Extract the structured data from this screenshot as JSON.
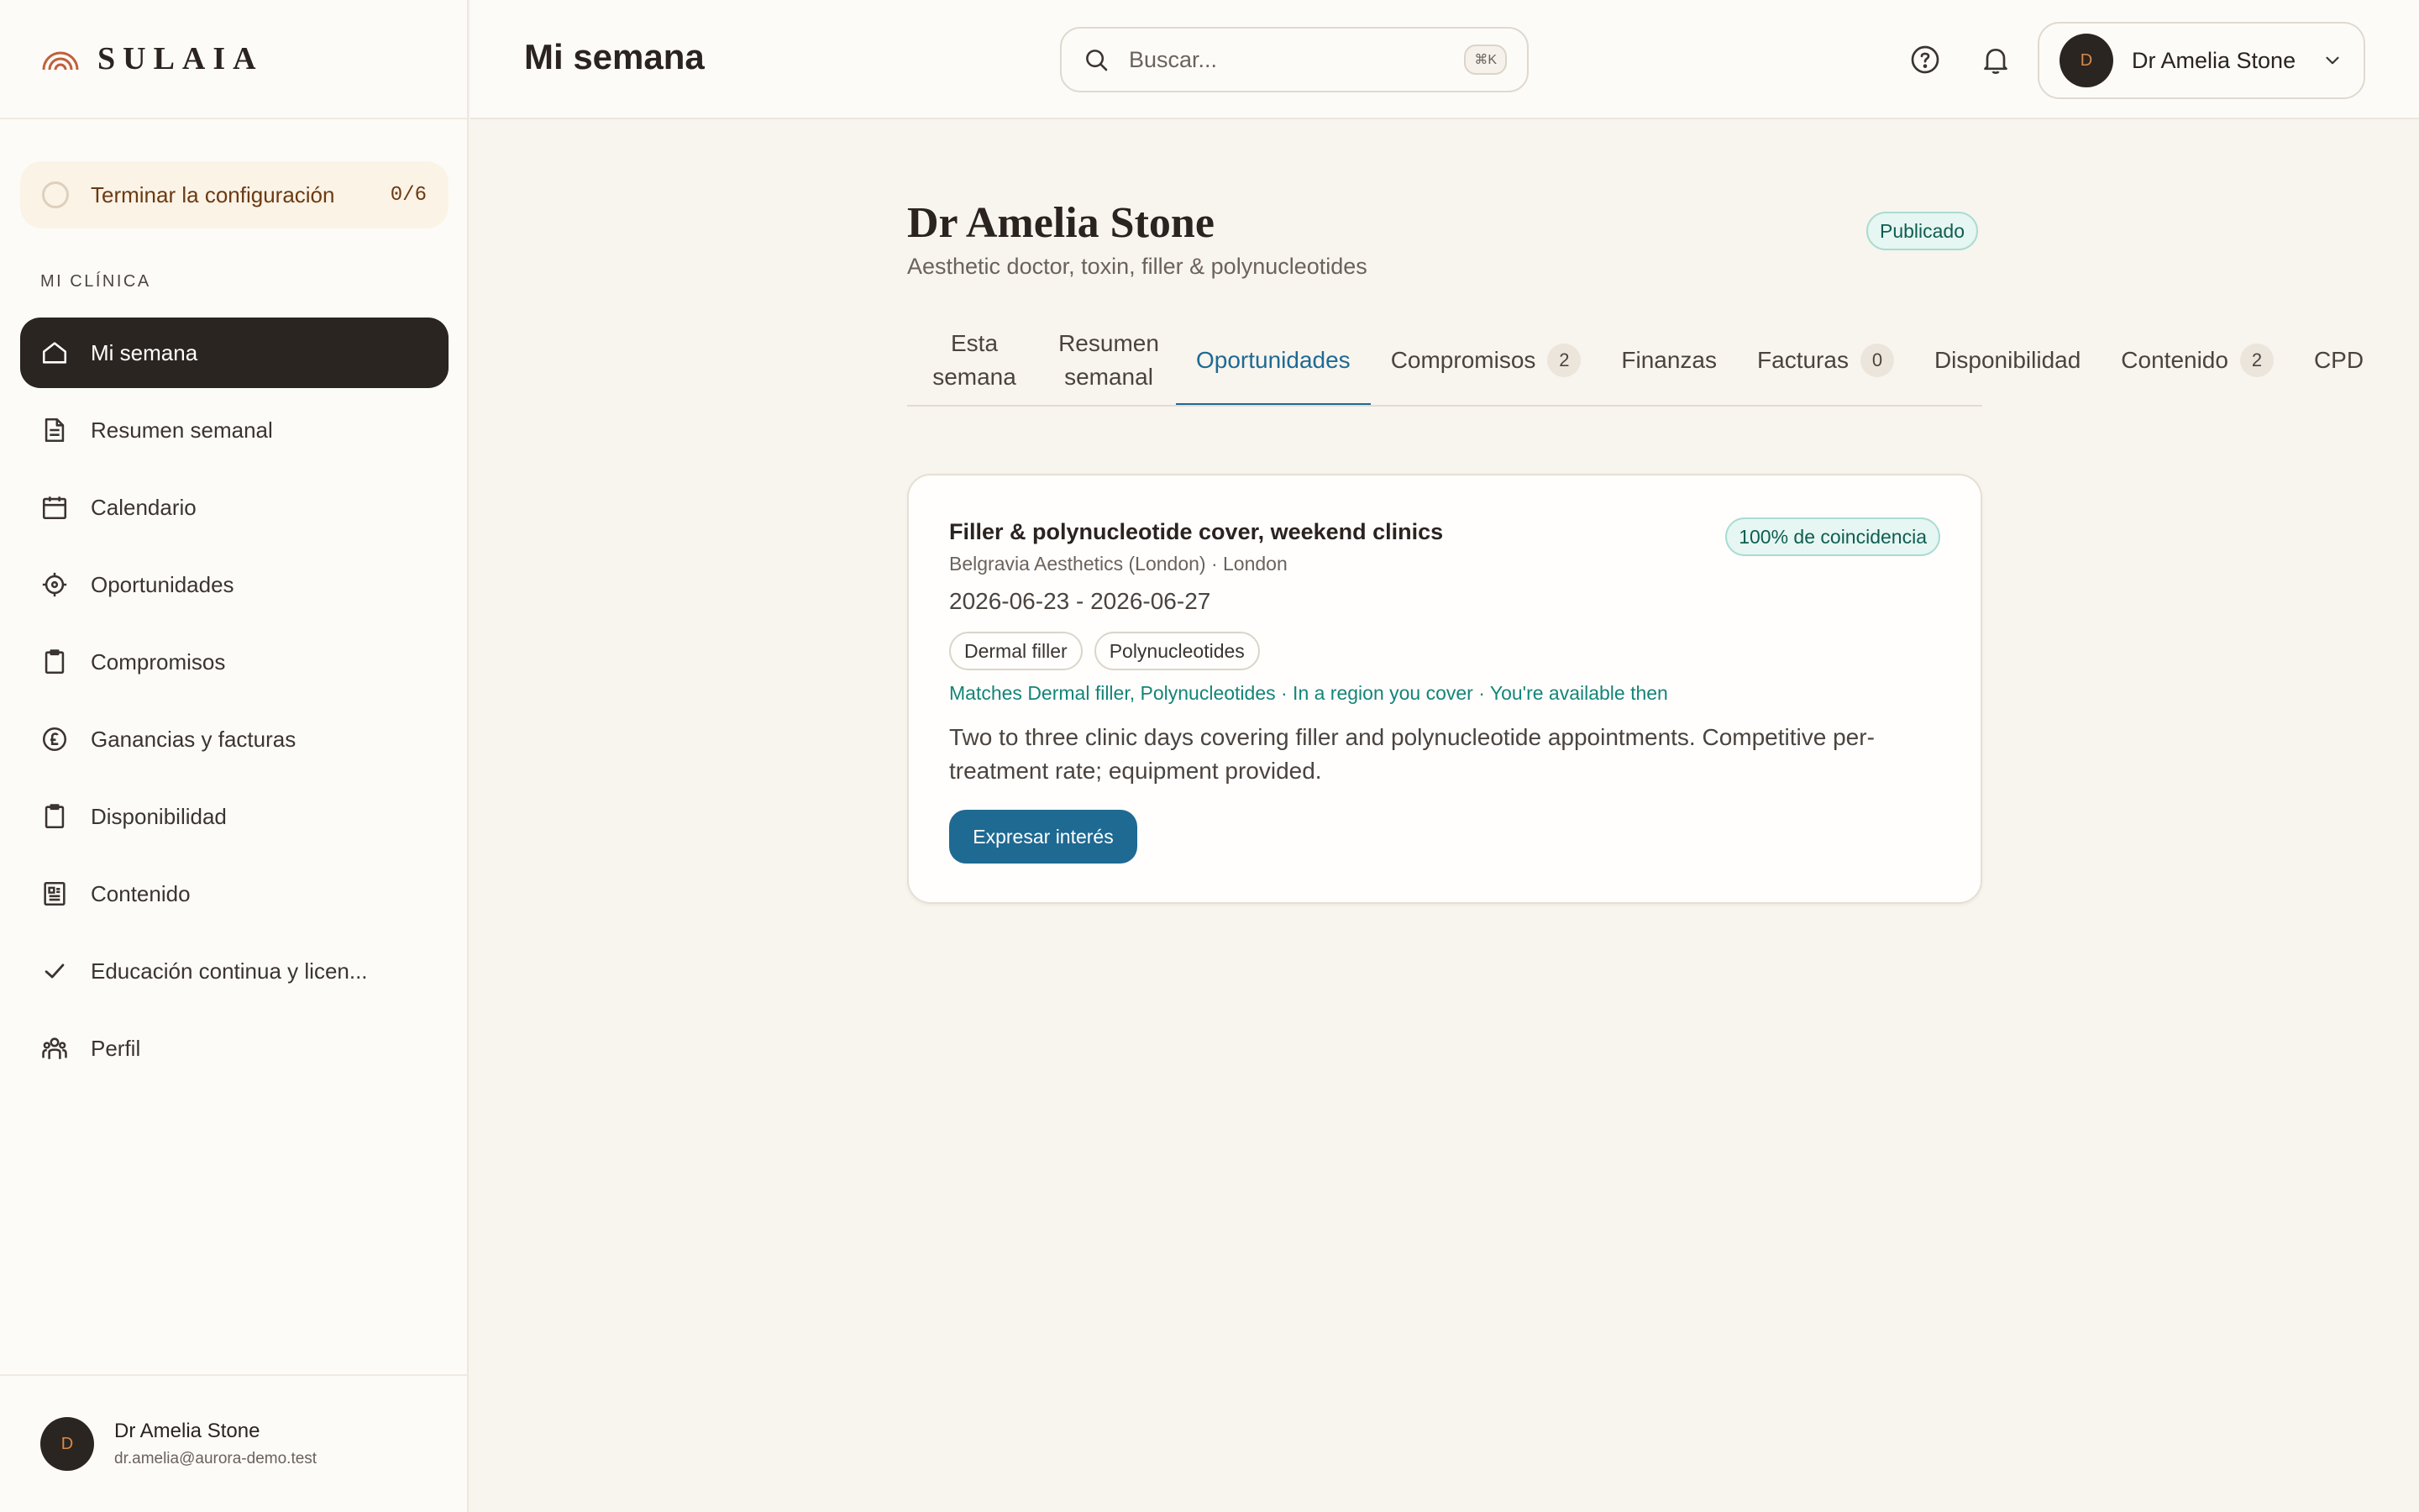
{
  "brand": {
    "name": "SULAIA",
    "logo_icon": "rainbow-arc-logo"
  },
  "sidebar": {
    "setup": {
      "label": "Terminar la configuración",
      "count": "0/6"
    },
    "section_label": "MI CLÍNICA",
    "items": [
      {
        "label": "Mi semana",
        "icon": "home-icon",
        "active": true
      },
      {
        "label": "Resumen semanal",
        "icon": "document-icon"
      },
      {
        "label": "Calendario",
        "icon": "calendar-icon"
      },
      {
        "label": "Oportunidades",
        "icon": "crosshair-icon"
      },
      {
        "label": "Compromisos",
        "icon": "clipboard-icon"
      },
      {
        "label": "Ganancias y facturas",
        "icon": "pound-coin-icon"
      },
      {
        "label": "Disponibilidad",
        "icon": "clipboard-icon"
      },
      {
        "label": "Contenido",
        "icon": "newspaper-icon"
      },
      {
        "label": "Educación continua y licen...",
        "icon": "check-icon"
      },
      {
        "label": "Perfil",
        "icon": "users-icon"
      }
    ],
    "footer": {
      "avatar_initial": "D",
      "name": "Dr Amelia Stone",
      "email": "dr.amelia@aurora-demo.test"
    }
  },
  "header": {
    "title": "Mi semana",
    "search": {
      "placeholder": "Buscar...",
      "shortcut": "⌘K"
    },
    "user": {
      "avatar_initial": "D",
      "name": "Dr Amelia Stone"
    }
  },
  "profile": {
    "name": "Dr Amelia Stone",
    "subtitle": "Aesthetic doctor, toxin, filler & polynucleotides",
    "status": "Publicado"
  },
  "tabs": [
    {
      "label": "Esta semana",
      "two_line": true
    },
    {
      "label": "Resumen semanal",
      "two_line": true
    },
    {
      "label": "Oportunidades",
      "active": true
    },
    {
      "label": "Compromisos",
      "badge": "2"
    },
    {
      "label": "Finanzas"
    },
    {
      "label": "Facturas",
      "badge": "0"
    },
    {
      "label": "Disponibilidad"
    },
    {
      "label": "Contenido",
      "badge": "2"
    },
    {
      "label": "CPD"
    }
  ],
  "opportunity": {
    "title": "Filler & polynucleotide cover, weekend clinics",
    "match": "100% de coincidencia",
    "clinic": "Belgravia Aesthetics (London) · London",
    "dates": "2026-06-23 - 2026-06-27",
    "tags": [
      "Dermal filler",
      "Polynucleotides"
    ],
    "reasons": "Matches Dermal filler, Polynucleotides · In a region you cover · You're available then",
    "description": "Two to three clinic days covering filler and polynucleotide appointments. Competitive per-treatment rate; equipment provided.",
    "cta": "Expresar interés"
  },
  "colors": {
    "accent": "#1e6a93",
    "sidebar_active": "#2b2521",
    "match_green": "#138577",
    "setup_bg": "#fbf3e6"
  }
}
